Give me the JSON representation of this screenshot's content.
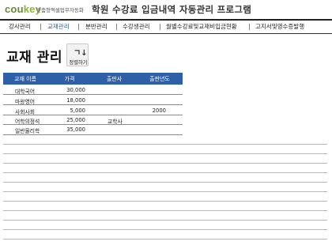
{
  "header": {
    "logo_main": "cou",
    "logo_accent": "key",
    "logo_sub": "맞춤형엑셀업무자동화",
    "title": "학원 수강료 입금내역 자동관리 프로그램"
  },
  "menu": {
    "items": [
      {
        "label": "강사관리"
      },
      {
        "label": "교재관리"
      },
      {
        "label": "분반관리"
      },
      {
        "label": "수강생관리"
      },
      {
        "label": "월별수강료및교재비입금현황"
      },
      {
        "label": "고지서및영수증발행"
      }
    ],
    "active": "교재관리"
  },
  "page": {
    "title": "교재 관리",
    "sort_button": {
      "glyph": "ㄱ↓",
      "label": "정렬하기"
    }
  },
  "table": {
    "columns": [
      "교재 이름",
      "가격",
      "출판사",
      "출판년도"
    ],
    "rows": [
      {
        "name": "대학국어",
        "price": "30,000",
        "publisher": "",
        "year": ""
      },
      {
        "name": "마왕영어",
        "price": "18,000",
        "publisher": "",
        "year": ""
      },
      {
        "name": "사회사회",
        "price": "5,000",
        "publisher": "",
        "year": "2000"
      },
      {
        "name": "어학의정석",
        "price": "25,000",
        "publisher": "교학사",
        "year": ""
      },
      {
        "name": "일반물리학",
        "price": "35,000",
        "publisher": "",
        "year": ""
      }
    ]
  },
  "colors": {
    "header_blue": "#2f5fa7",
    "logo_green": "#6a8a2c",
    "active_menu": "#2d5a9a"
  }
}
